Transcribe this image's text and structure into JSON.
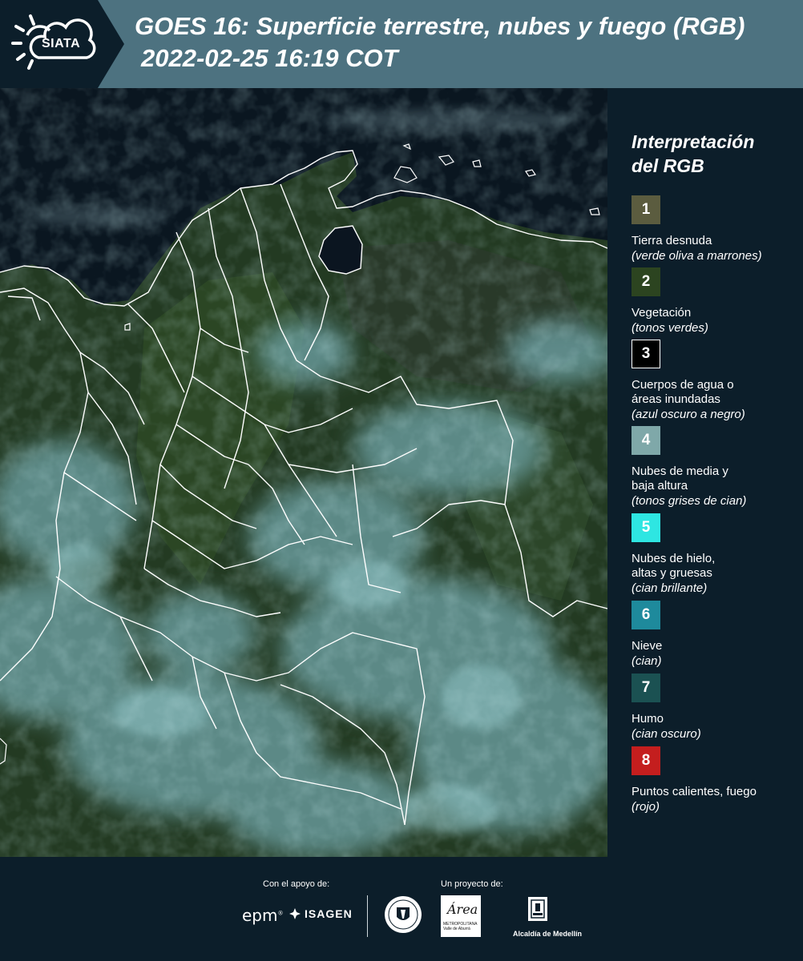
{
  "header": {
    "logo_text": "SIATA",
    "title": "GOES 16: Superficie terrestre, nubes y fuego (RGB)",
    "subtitle": "2022-02-25 16:19 COT"
  },
  "legend": {
    "title_line1": "Interpretación",
    "title_line2": "del RGB",
    "items": [
      {
        "number": "1",
        "color": "#5b5c3f",
        "text_color": "#ffffff",
        "label": "Tierra desnuda",
        "sub": "(verde oliva a marrones)"
      },
      {
        "number": "2",
        "color": "#2c4420",
        "text_color": "#ffffff",
        "label": "Vegetación",
        "sub": "(tonos verdes)"
      },
      {
        "number": "3",
        "color": "#000000",
        "text_color": "#ffffff",
        "border": "#ffffff",
        "label": "Cuerpos de agua o",
        "label2": "áreas inundadas",
        "sub": "(azul oscuro a negro)"
      },
      {
        "number": "4",
        "color": "#7fa8a9",
        "text_color": "#ffffff",
        "label": "Nubes de media y",
        "label2": "baja altura",
        "sub": "(tonos grises de cian)"
      },
      {
        "number": "5",
        "color": "#2ee6e2",
        "text_color": "#ffffff",
        "label": "Nubes de hielo,",
        "label2": "altas y gruesas",
        "sub": "(cian brillante)"
      },
      {
        "number": "6",
        "color": "#1e8a9c",
        "text_color": "#ffffff",
        "label": "Nieve",
        "sub": "(cian)"
      },
      {
        "number": "7",
        "color": "#1b5152",
        "text_color": "#ffffff",
        "label": "Humo",
        "sub": "(cian oscuro)"
      },
      {
        "number": "8",
        "color": "#c41e1e",
        "text_color": "#ffffff",
        "label": "Puntos calientes, fuego",
        "sub": "(rojo)"
      }
    ]
  },
  "footer": {
    "support_label": "Con el apoyo de:",
    "project_label": "Un proyecto de:",
    "epm": "epm",
    "isagen": "ISAGEN",
    "alcaldia": "Alcaldía de Medellín",
    "area": "Área",
    "area_small": "METROPOLITANA Valle de Aburrá"
  },
  "colors": {
    "header_bg": "#4d7280",
    "page_bg": "#0c1e2a",
    "vegetation": "#2a4424",
    "cloud": "#7fb1b3"
  }
}
